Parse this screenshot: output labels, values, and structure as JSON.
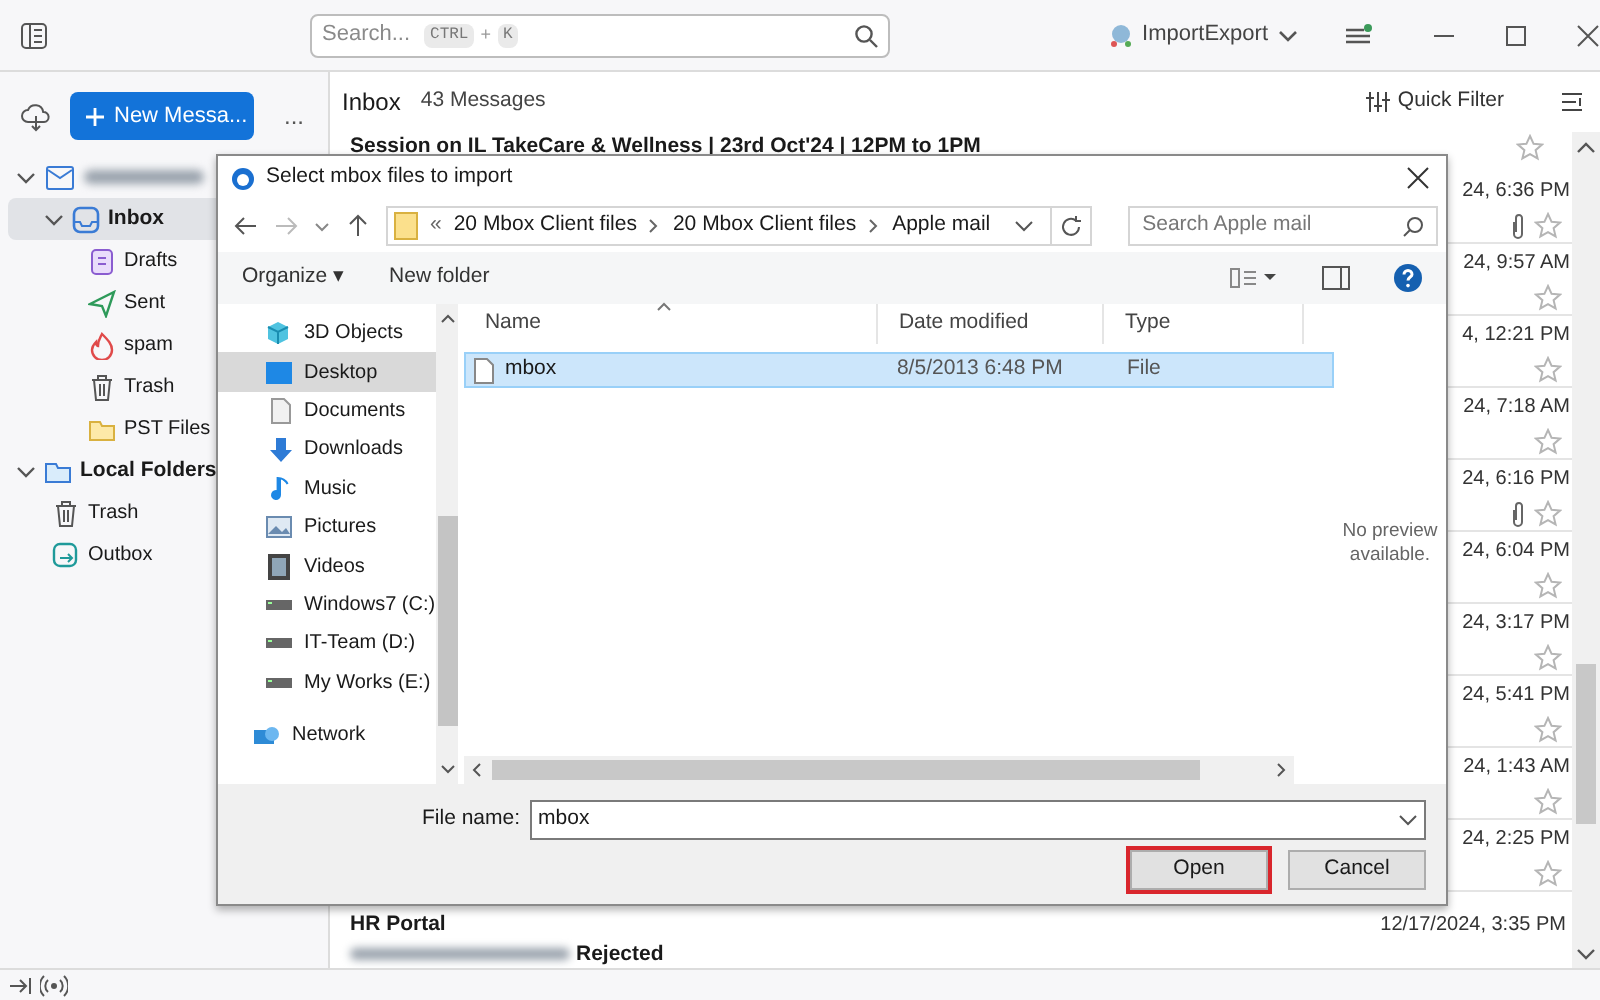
{
  "topbar": {
    "search_placeholder": "Search...",
    "shortcut": [
      "CTRL",
      "+",
      "K"
    ],
    "account": "ImportExport"
  },
  "sidebar": {
    "new_button": "New Messa...",
    "more": "...",
    "folders": [
      {
        "label": "Inbox",
        "kind": "inbox",
        "selected": true,
        "expanded": true,
        "children": [
          {
            "label": "Drafts",
            "kind": "drafts",
            "selected": false
          },
          {
            "label": "Sent",
            "kind": "sent",
            "selected": false
          },
          {
            "label": "spam",
            "kind": "spam",
            "selected": false
          },
          {
            "label": "Trash",
            "kind": "trash",
            "selected": false
          },
          {
            "label": "PST Files",
            "kind": "folder",
            "selected": false
          }
        ]
      },
      {
        "label": "Local Folders",
        "kind": "localfolder",
        "selected": false,
        "expanded": true,
        "children": [
          {
            "label": "Trash",
            "kind": "trash",
            "selected": false
          },
          {
            "label": "Outbox",
            "kind": "outbox",
            "selected": false
          }
        ]
      }
    ]
  },
  "message_list": {
    "folder": "Inbox",
    "count": "43 Messages",
    "quick_filter": "Quick Filter",
    "rows": [
      {
        "text": "Session on IL TakeCare & Wellness | 23rd Oct'24 | 12PM to 1PM",
        "kind": "subject"
      },
      {
        "text": "24, 6:36 PM",
        "kind": "date",
        "attachment": true
      },
      {
        "text": "24, 9:57 AM",
        "kind": "date",
        "attachment": false
      },
      {
        "text": "4, 12:21 PM",
        "kind": "date",
        "attachment": false
      },
      {
        "text": "24, 7:18 AM",
        "kind": "date",
        "attachment": false
      },
      {
        "text": "24, 6:16 PM",
        "kind": "date",
        "attachment": true
      },
      {
        "text": "24, 6:04 PM",
        "kind": "date",
        "attachment": false
      },
      {
        "text": "24, 3:17 PM",
        "kind": "date",
        "attachment": false
      },
      {
        "text": "24, 5:41 PM",
        "kind": "date",
        "attachment": false
      },
      {
        "text": "24, 1:43 AM",
        "kind": "date",
        "attachment": false
      },
      {
        "text": "24, 2:25 PM",
        "kind": "date",
        "attachment": false
      },
      {
        "text": "HR Portal",
        "date": "12/17/2024, 3:35 PM",
        "snippet": "Rejected",
        "kind": "full"
      }
    ]
  },
  "dialog": {
    "title": "Select mbox files to import",
    "path": [
      "«",
      "20 Mbox Client files",
      "20 Mbox Client files",
      "Apple mail"
    ],
    "search_placeholder": "Search Apple mail",
    "organize": "Organize ▾",
    "new_folder": "New folder",
    "nav": [
      {
        "label": "3D Objects",
        "kind": "cube",
        "selected": false
      },
      {
        "label": "Desktop",
        "kind": "desktop",
        "selected": true
      },
      {
        "label": "Documents",
        "kind": "doc",
        "selected": false
      },
      {
        "label": "Downloads",
        "kind": "download",
        "selected": false
      },
      {
        "label": "Music",
        "kind": "music",
        "selected": false
      },
      {
        "label": "Pictures",
        "kind": "pictures",
        "selected": false
      },
      {
        "label": "Videos",
        "kind": "video",
        "selected": false
      },
      {
        "label": "Windows7 (C:)",
        "kind": "drive",
        "selected": false
      },
      {
        "label": "IT-Team (D:)",
        "kind": "drive",
        "selected": false
      },
      {
        "label": "My Works (E:)",
        "kind": "drive",
        "selected": false
      },
      {
        "label": "Network",
        "kind": "network",
        "selected": false
      }
    ],
    "columns": [
      "Name",
      "Date modified",
      "Type"
    ],
    "files": [
      {
        "name": "mbox",
        "date": "8/5/2013 6:48 PM",
        "type": "File",
        "selected": true
      }
    ],
    "preview": "No preview available.",
    "file_name_label": "File name:",
    "file_name": "mbox",
    "buttons": [
      {
        "label": "Open",
        "highlighted": true
      },
      {
        "label": "Cancel",
        "highlighted": false
      }
    ]
  }
}
